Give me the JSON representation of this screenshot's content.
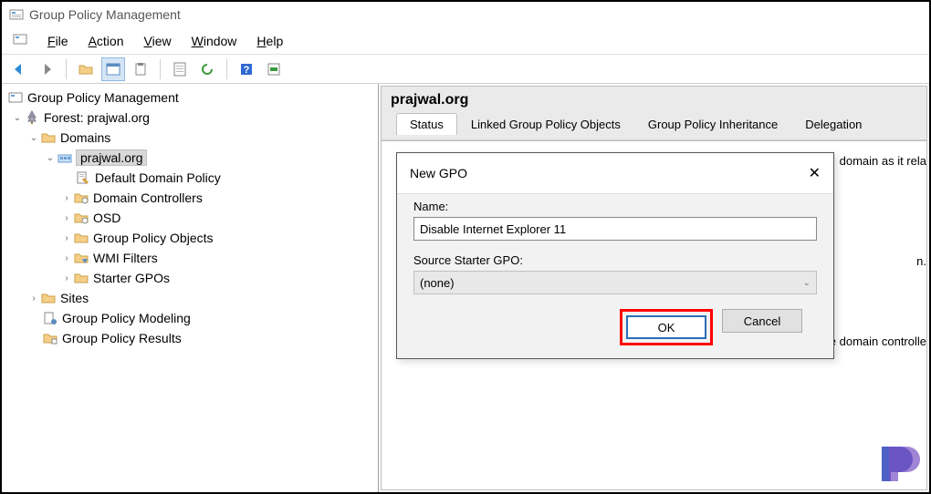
{
  "titlebar": {
    "title": "Group Policy Management"
  },
  "menu": {
    "file": "File",
    "action": "Action",
    "view": "View",
    "window": "Window",
    "help": "Help"
  },
  "tree": {
    "root": "Group Policy Management",
    "forest": "Forest: prajwal.org",
    "domains": "Domains",
    "domain": "prajwal.org",
    "ddp": "Default Domain Policy",
    "dc": "Domain Controllers",
    "osd": "OSD",
    "gpo": "Group Policy Objects",
    "wmi": "WMI Filters",
    "starter": "Starter GPOs",
    "sites": "Sites",
    "modeling": "Group Policy Modeling",
    "results": "Group Policy Results"
  },
  "detail": {
    "title": "prajwal.org",
    "tabs": {
      "status": "Status",
      "linked": "Linked Group Policy Objects",
      "inherit": "Group Policy Inheritance",
      "deleg": "Delegation"
    },
    "body_snip1": "domain as it rela",
    "body_snip2": "n.",
    "body_snip3": "e domain controlle"
  },
  "dialog": {
    "title": "New GPO",
    "name_label": "Name:",
    "name_value": "Disable Internet Explorer 11",
    "source_label": "Source Starter GPO:",
    "source_value": "(none)",
    "ok": "OK",
    "cancel": "Cancel"
  }
}
